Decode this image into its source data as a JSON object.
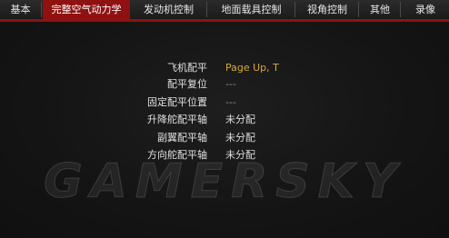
{
  "tabs": [
    {
      "label": "基本",
      "active": false
    },
    {
      "label": "完整空气动力学",
      "active": true
    },
    {
      "label": "发动机控制",
      "active": false
    },
    {
      "label": "地面载具控制",
      "active": false
    },
    {
      "label": "视角控制",
      "active": false
    },
    {
      "label": "其他",
      "active": false
    },
    {
      "label": "录像",
      "active": false
    }
  ],
  "controls": [
    {
      "label": "飞机配平",
      "value": "Page Up, T"
    },
    {
      "label": "配平复位",
      "value": "---"
    },
    {
      "label": "固定配平位置",
      "value": "---"
    },
    {
      "label": "升降舵配平轴",
      "value": "未分配"
    },
    {
      "label": "副翼配平轴",
      "value": "未分配"
    },
    {
      "label": "方向舵配平轴",
      "value": "未分配"
    }
  ],
  "watermark": "GAMERSKY",
  "colors": {
    "accent": "#8f1212",
    "highlight": "#d9a937",
    "background": "#141414"
  }
}
